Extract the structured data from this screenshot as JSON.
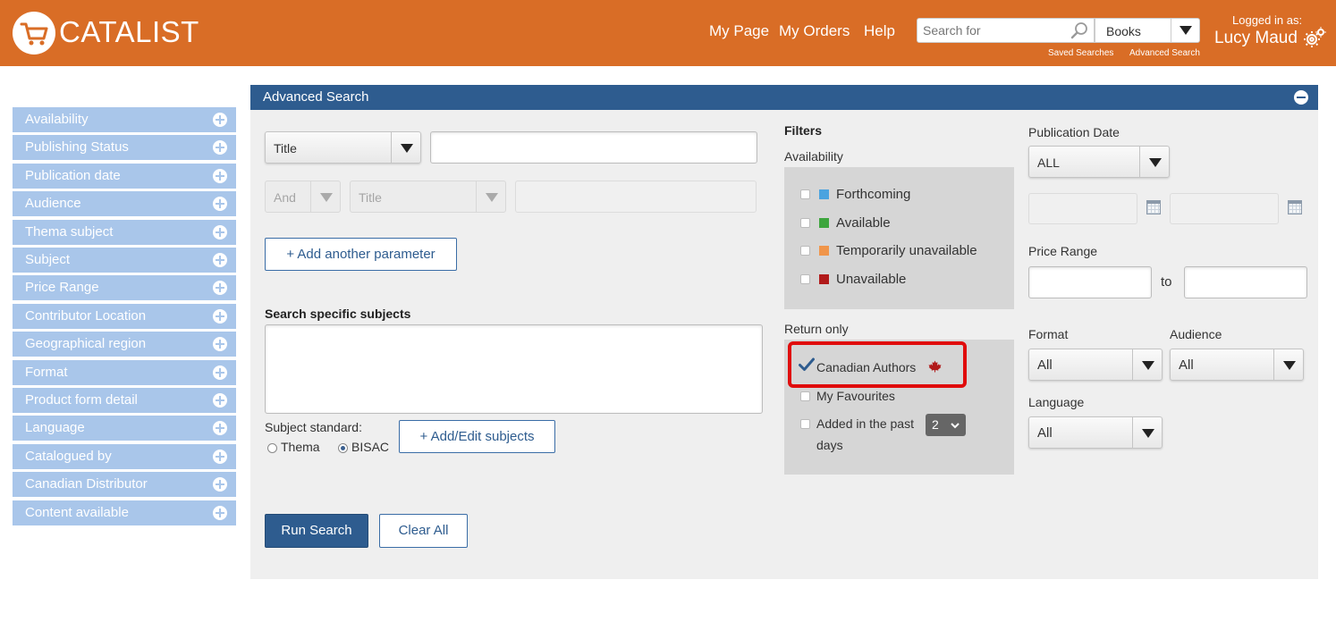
{
  "header": {
    "logo": "CATALIST",
    "nav": [
      "My Page",
      "My Orders",
      "Help"
    ],
    "search_placeholder": "Search for",
    "search_type": "Books",
    "saved_searches": "Saved Searches",
    "advanced_search": "Advanced Search",
    "logged_in_label": "Logged in as:",
    "user_name": "Lucy Maud"
  },
  "sidebar": {
    "items": [
      "Availability",
      "Publishing Status",
      "Publication date",
      "Audience",
      "Thema subject",
      "Subject",
      "Price Range",
      "Contributor Location",
      "Geographical region",
      "Format",
      "Product form detail",
      "Language",
      "Catalogued by",
      "Canadian Distributor",
      "Content available"
    ]
  },
  "panel": {
    "title": "Advanced Search",
    "field_select": "Title",
    "bool_select": "And",
    "field_select_2": "Title",
    "add_param": "+ Add another parameter",
    "subjects_heading": "Search specific subjects",
    "subject_standard_label": "Subject standard:",
    "subject_options": [
      "Thema",
      "BISAC"
    ],
    "subject_selected": "BISAC",
    "add_edit_subjects": "+ Add/Edit subjects",
    "run_search": "Run Search",
    "clear_all": "Clear All"
  },
  "filters": {
    "heading": "Filters",
    "availability_label": "Availability",
    "availability": [
      {
        "label": "Forthcoming",
        "color": "#4aa3df"
      },
      {
        "label": "Available",
        "color": "#3da53d"
      },
      {
        "label": "Temporarily unavailable",
        "color": "#f0954a"
      },
      {
        "label": "Unavailable",
        "color": "#b11a1a"
      }
    ],
    "return_only_label": "Return only",
    "canadian_authors": "Canadian Authors",
    "canadian_authors_checked": true,
    "my_favourites": "My Favourites",
    "added_in_past": "Added in the past",
    "added_days_value": "2",
    "days": "days"
  },
  "right": {
    "pub_date_label": "Publication Date",
    "pub_date_value": "ALL",
    "price_range_label": "Price Range",
    "to": "to",
    "format_label": "Format",
    "format_value": "All",
    "audience_label": "Audience",
    "audience_value": "All",
    "language_label": "Language",
    "language_value": "All"
  },
  "colors": {
    "header_bg": "#d96d26",
    "panel_header_bg": "#2e5c8f",
    "sidebar_bg": "#a9c6ea",
    "highlight": "#e00b0b"
  }
}
